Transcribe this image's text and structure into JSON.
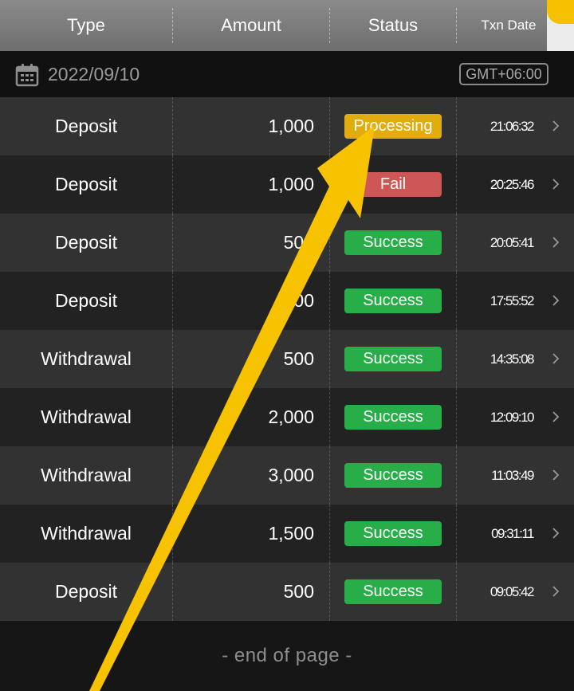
{
  "header": {
    "columns": {
      "type": "Type",
      "amount": "Amount",
      "status": "Status",
      "date": "Txn Date"
    }
  },
  "date_bar": {
    "date": "2022/09/10",
    "timezone": "GMT+06:00",
    "icon": "calendar-icon"
  },
  "transactions": [
    {
      "type": "Deposit",
      "amount": "1,000",
      "status": "Processing",
      "status_kind": "processing",
      "time": "21:06:32"
    },
    {
      "type": "Deposit",
      "amount": "1,000",
      "status": "Fail",
      "status_kind": "fail",
      "time": "20:25:46"
    },
    {
      "type": "Deposit",
      "amount": "500",
      "status": "Success",
      "status_kind": "success",
      "time": "20:05:41"
    },
    {
      "type": "Deposit",
      "amount": "500",
      "status": "Success",
      "status_kind": "success",
      "time": "17:55:52"
    },
    {
      "type": "Withdrawal",
      "amount": "500",
      "status": "Success",
      "status_kind": "success",
      "time": "14:35:08"
    },
    {
      "type": "Withdrawal",
      "amount": "2,000",
      "status": "Success",
      "status_kind": "success",
      "time": "12:09:10"
    },
    {
      "type": "Withdrawal",
      "amount": "3,000",
      "status": "Success",
      "status_kind": "success",
      "time": "11:03:49"
    },
    {
      "type": "Withdrawal",
      "amount": "1,500",
      "status": "Success",
      "status_kind": "success",
      "time": "09:31:11"
    },
    {
      "type": "Deposit",
      "amount": "500",
      "status": "Success",
      "status_kind": "success",
      "time": "09:05:42"
    }
  ],
  "footer": {
    "text": "- end of page -"
  },
  "colors": {
    "success": "#27ae48",
    "fail": "#cf5656",
    "processing": "#e0ac0e",
    "annotation_arrow": "#f7c200"
  },
  "icons": {
    "row_chevron": "chevron-right-icon",
    "annotation": "annotation-arrow-icon"
  }
}
